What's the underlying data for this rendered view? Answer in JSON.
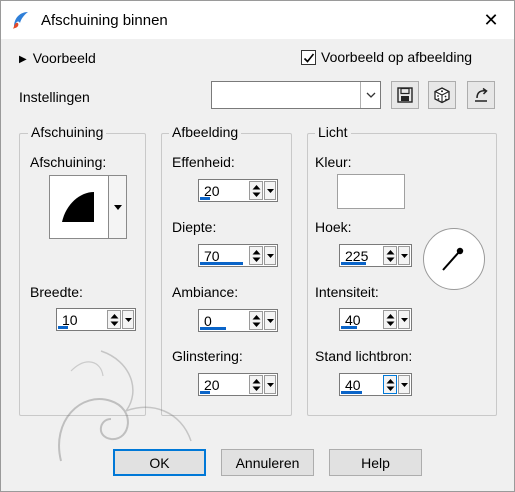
{
  "window": {
    "title": "Afschuining binnen",
    "close_icon": "close-icon",
    "app_icon": "paint-brush-icon"
  },
  "preview": {
    "toggle_label": "Voorbeeld",
    "on_image_label": "Voorbeeld op afbeelding",
    "on_image_checked": true
  },
  "settings": {
    "label": "Instellingen",
    "value": "",
    "icons": [
      "save-icon",
      "dice-icon",
      "reset-icon"
    ]
  },
  "bevel": {
    "group_label": "Afschuining",
    "shape_label": "Afschuining:",
    "width_label": "Breedte:",
    "width_value": "10",
    "width_fill": 0.2
  },
  "image": {
    "group_label": "Afbeelding",
    "smoothness_label": "Effenheid:",
    "smoothness_value": "20",
    "smoothness_fill": 0.2,
    "depth_label": "Diepte:",
    "depth_value": "70",
    "depth_fill": 0.9,
    "ambience_label": "Ambiance:",
    "ambience_value": "0",
    "ambience_fill": 0.55,
    "shininess_label": "Glinstering:",
    "shininess_value": "20",
    "shininess_fill": 0.2
  },
  "light": {
    "group_label": "Licht",
    "color_label": "Kleur:",
    "color_value": "#ffffff",
    "angle_label": "Hoek:",
    "angle_value": "225",
    "angle_fill": 0.62,
    "intensity_label": "Intensiteit:",
    "intensity_value": "40",
    "intensity_fill": 0.4,
    "elevation_label": "Stand lichtbron:",
    "elevation_value": "40",
    "elevation_fill": 0.5
  },
  "buttons": {
    "ok": "OK",
    "cancel": "Annuleren",
    "help": "Help"
  },
  "colors": {
    "accent": "#0a64c8",
    "focus": "#0078d7"
  }
}
